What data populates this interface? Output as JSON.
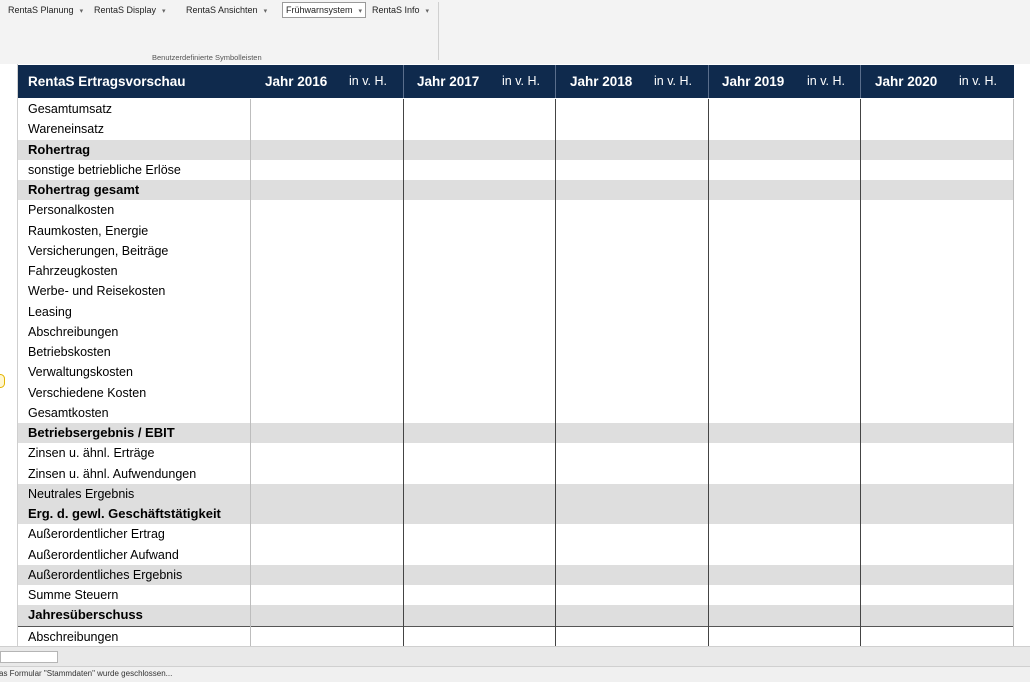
{
  "ribbon": {
    "items": [
      {
        "label": "RentaS Planung"
      },
      {
        "label": "RentaS Display"
      },
      {
        "label": "RentaS Ansichten"
      },
      {
        "label": "Frühwarnsystem"
      },
      {
        "label": "RentaS Info"
      }
    ],
    "group_label": "Benutzerdefinierte Symbolleisten",
    "caret": "▾"
  },
  "table": {
    "title": "RentaS Ertragsvorschau",
    "years": [
      {
        "label": "Jahr 2016",
        "sub": "in v. H."
      },
      {
        "label": "Jahr 2017",
        "sub": "in v. H."
      },
      {
        "label": "Jahr 2018",
        "sub": "in v. H."
      },
      {
        "label": "Jahr 2019",
        "sub": "in v. H."
      },
      {
        "label": "Jahr 2020",
        "sub": "in v. H."
      }
    ],
    "rows": [
      {
        "label": "Gesamtumsatz"
      },
      {
        "label": "Wareneinsatz"
      },
      {
        "label": "Rohertrag",
        "bold": true,
        "shade": true
      },
      {
        "label": "sonstige betriebliche Erlöse"
      },
      {
        "label": "Rohertrag gesamt",
        "bold": true,
        "shade": true
      },
      {
        "label": "Personalkosten"
      },
      {
        "label": "Raumkosten,  Energie"
      },
      {
        "label": "Versicherungen, Beiträge"
      },
      {
        "label": "Fahrzeugkosten"
      },
      {
        "label": "Werbe- und Reisekosten"
      },
      {
        "label": "Leasing"
      },
      {
        "label": "Abschreibungen"
      },
      {
        "label": "Betriebskosten"
      },
      {
        "label": "Verwaltungskosten"
      },
      {
        "label": "Verschiedene Kosten"
      },
      {
        "label": "Gesamtkosten"
      },
      {
        "label": "Betriebsergebnis / EBIT",
        "bold": true,
        "shade": true
      },
      {
        "label": "Zinsen u. ähnl. Erträge"
      },
      {
        "label": "Zinsen u. ähnl. Aufwendungen"
      },
      {
        "label": "Neutrales Ergebnis",
        "shade": true
      },
      {
        "label": "Erg. d. gewl. Geschäftstätigkeit",
        "bold": true,
        "shade": true
      },
      {
        "label": "Außerordentlicher Ertrag"
      },
      {
        "label": "Außerordentlicher Aufwand"
      },
      {
        "label": "Außerordentliches Ergebnis",
        "shade": true
      },
      {
        "label": "Summe Steuern"
      },
      {
        "label": "Jahresüberschuss",
        "bold": true,
        "shade": true
      },
      {
        "label": "Abschreibungen",
        "topline": true
      }
    ]
  },
  "status": {
    "message": "as Formular \"Stammdaten\" wurde geschlossen..."
  },
  "colors": {
    "header_bg": "#0f2a4d",
    "row_shade": "#dedede"
  }
}
